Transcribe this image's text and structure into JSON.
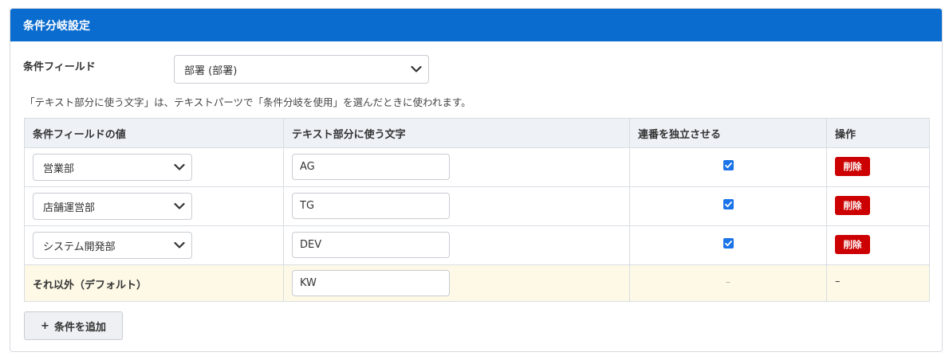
{
  "panel": {
    "title": "条件分岐設定"
  },
  "condition_field": {
    "label": "条件フィールド",
    "selected": "部署 (部署)"
  },
  "note": "「テキスト部分に使う文字」は、テキストパーツで「条件分岐を使用」を選んだときに使われます。",
  "table": {
    "headers": [
      "条件フィールドの値",
      "テキスト部分に使う文字",
      "連番を独立させる",
      "操作"
    ],
    "rows": [
      {
        "value": "営業部",
        "text": "AG",
        "independent": true,
        "action": "削除"
      },
      {
        "value": "店舗運営部",
        "text": "TG",
        "independent": true,
        "action": "削除"
      },
      {
        "value": "システム開発部",
        "text": "DEV",
        "independent": true,
        "action": "削除"
      }
    ],
    "default_row": {
      "label": "それ以外（デフォルト）",
      "text": "KW",
      "independent": "–",
      "action": "–"
    }
  },
  "add_button": {
    "icon": "+",
    "label": "条件を追加"
  },
  "colors": {
    "header_bg": "#0a6ccf",
    "delete_bg": "#cc0000",
    "checkbox": "#1a73e8",
    "default_row_bg": "#fdf9e6"
  },
  "icons": {
    "select_arrow": "chevron-down-icon",
    "checkbox": "check-icon",
    "add": "plus-icon"
  }
}
